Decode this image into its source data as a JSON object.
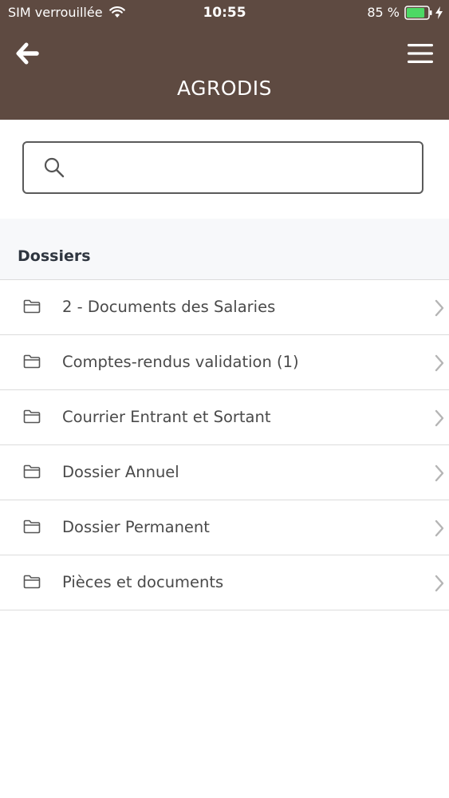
{
  "status_bar": {
    "carrier": "SIM verrouillée",
    "time": "10:55",
    "battery_percent": "85 %",
    "battery_level": 0.85
  },
  "header": {
    "title": "AGRODIS",
    "back_icon": "arrow-left-icon",
    "menu_icon": "hamburger-menu-icon",
    "background_color": "#5e4a41"
  },
  "search": {
    "value": "",
    "placeholder": "",
    "icon": "search-icon"
  },
  "section": {
    "title": "Dossiers"
  },
  "folders": [
    {
      "label": "2 - Documents des Salaries"
    },
    {
      "label": "Comptes-rendus validation (1)"
    },
    {
      "label": "Courrier Entrant et Sortant"
    },
    {
      "label": "Dossier Annuel"
    },
    {
      "label": "Dossier Permanent"
    },
    {
      "label": "Pièces et documents"
    }
  ]
}
